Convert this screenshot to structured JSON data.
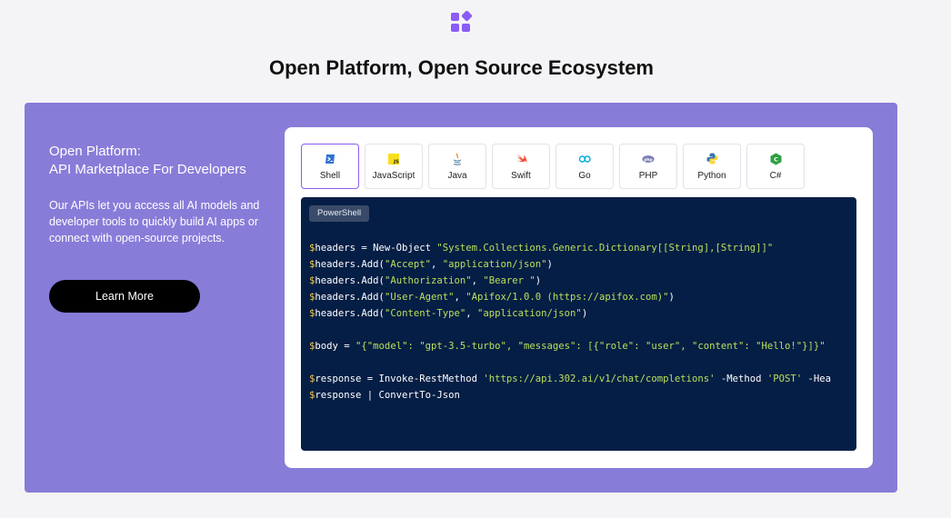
{
  "page": {
    "title": "Open Platform, Open Source Ecosystem"
  },
  "colors": {
    "panel_bg": "#877cd8",
    "logo": "#8b5cf6",
    "code_bg": "#051e45",
    "active_tab_border": "#8a5cf0",
    "code_var": "#f2c94c",
    "code_string": "#b8e05a"
  },
  "left": {
    "heading_line1": "Open Platform:",
    "heading_line2": "API Marketplace For Developers",
    "description": "Our APIs let you access all AI models and developer tools to quickly build AI apps or connect with open-source projects.",
    "button_label": "Learn More"
  },
  "tabs": [
    {
      "label": "Shell",
      "icon": "shell-icon",
      "active": true
    },
    {
      "label": "JavaScript",
      "icon": "javascript-icon",
      "active": false
    },
    {
      "label": "Java",
      "icon": "java-icon",
      "active": false
    },
    {
      "label": "Swift",
      "icon": "swift-icon",
      "active": false
    },
    {
      "label": "Go",
      "icon": "go-icon",
      "active": false
    },
    {
      "label": "PHP",
      "icon": "php-icon",
      "active": false
    },
    {
      "label": "Python",
      "icon": "python-icon",
      "active": false
    },
    {
      "label": "C#",
      "icon": "csharp-icon",
      "active": false
    }
  ],
  "code": {
    "badge": "PowerShell",
    "lines": [
      [
        {
          "t": "var",
          "s": "$"
        },
        {
          "t": "plain",
          "s": "headers = New-Object "
        },
        {
          "t": "str",
          "s": "\"System.Collections.Generic.Dictionary[[String],[String]]\""
        }
      ],
      [
        {
          "t": "var",
          "s": "$"
        },
        {
          "t": "plain",
          "s": "headers.Add("
        },
        {
          "t": "str",
          "s": "\"Accept\""
        },
        {
          "t": "plain",
          "s": ", "
        },
        {
          "t": "str",
          "s": "\"application/json\""
        },
        {
          "t": "plain",
          "s": ")"
        }
      ],
      [
        {
          "t": "var",
          "s": "$"
        },
        {
          "t": "plain",
          "s": "headers.Add("
        },
        {
          "t": "str",
          "s": "\"Authorization\""
        },
        {
          "t": "plain",
          "s": ", "
        },
        {
          "t": "str",
          "s": "\"Bearer \""
        },
        {
          "t": "plain",
          "s": ")"
        }
      ],
      [
        {
          "t": "var",
          "s": "$"
        },
        {
          "t": "plain",
          "s": "headers.Add("
        },
        {
          "t": "str",
          "s": "\"User-Agent\""
        },
        {
          "t": "plain",
          "s": ", "
        },
        {
          "t": "str",
          "s": "\"Apifox/1.0.0 (https://apifox.com)\""
        },
        {
          "t": "plain",
          "s": ")"
        }
      ],
      [
        {
          "t": "var",
          "s": "$"
        },
        {
          "t": "plain",
          "s": "headers.Add("
        },
        {
          "t": "str",
          "s": "\"Content-Type\""
        },
        {
          "t": "plain",
          "s": ", "
        },
        {
          "t": "str",
          "s": "\"application/json\""
        },
        {
          "t": "plain",
          "s": ")"
        }
      ],
      [],
      [
        {
          "t": "var",
          "s": "$"
        },
        {
          "t": "plain",
          "s": "body = "
        },
        {
          "t": "str",
          "s": "\"{\"model\": \"gpt-3.5-turbo\", \"messages\": [{\"role\": \"user\", \"content\": \"Hello!\"}]}\""
        }
      ],
      [],
      [
        {
          "t": "var",
          "s": "$"
        },
        {
          "t": "plain",
          "s": "response = Invoke-RestMethod "
        },
        {
          "t": "str",
          "s": "'https://api.302.ai/v1/chat/completions'"
        },
        {
          "t": "plain",
          "s": " -Method "
        },
        {
          "t": "str",
          "s": "'POST'"
        },
        {
          "t": "plain",
          "s": " -Hea"
        }
      ],
      [
        {
          "t": "var",
          "s": "$"
        },
        {
          "t": "plain",
          "s": "response | ConvertTo-Json"
        }
      ]
    ]
  }
}
